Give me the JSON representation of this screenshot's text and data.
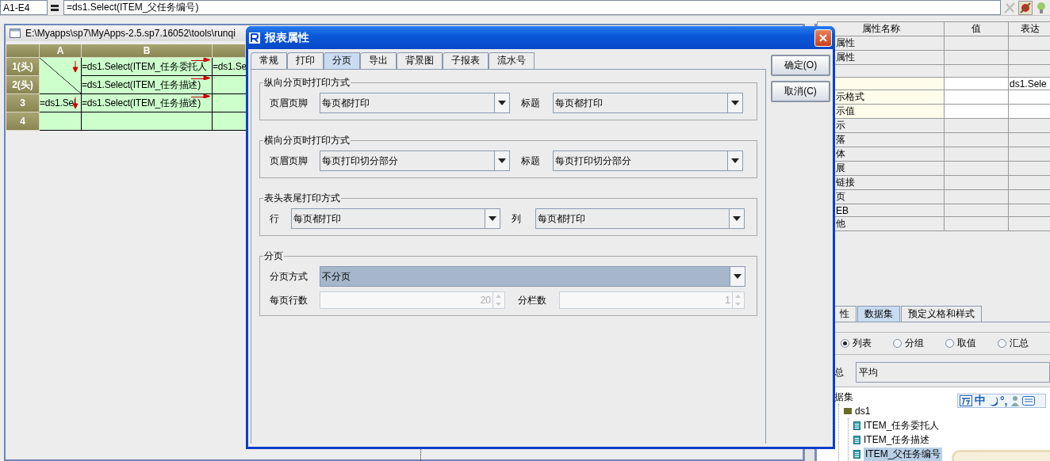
{
  "formula_bar": {
    "cell_ref": "A1-E4",
    "formula": "=ds1.Select(ITEM_父任务编号)"
  },
  "editor": {
    "title": "E:\\Myapps\\sp7\\MyApps-2.5.sp7.16052\\tools\\runqi",
    "columns": [
      "A",
      "B"
    ],
    "rows": [
      {
        "header": "1(头)",
        "cells": [
          {
            "kind": "diagonal",
            "down_arrow": true
          },
          {
            "kind": "text",
            "text": "=ds1.Select(ITEM_任务委托人",
            "right_arrow": true
          },
          {
            "kind": "text",
            "text": "=ds1.Se"
          }
        ]
      },
      {
        "header": "2(头)",
        "cells": [
          {
            "kind": "merged"
          },
          {
            "kind": "text",
            "text": "=ds1.Select(ITEM_任务描述)",
            "right_arrow": true
          },
          {
            "kind": "text"
          }
        ]
      },
      {
        "header": "3",
        "cells": [
          {
            "kind": "text",
            "text": "=ds1.Sel",
            "down_arrow": true
          },
          {
            "kind": "text",
            "text": "=ds1.Select(ITEM_任务描述)",
            "right_arrow": true
          },
          {
            "kind": "text"
          }
        ]
      },
      {
        "header": "4",
        "cells": [
          {
            "kind": "text"
          },
          {
            "kind": "text"
          },
          {
            "kind": "text"
          }
        ]
      }
    ]
  },
  "properties": {
    "columns": [
      "属性名称",
      "值",
      "表达"
    ],
    "rows": [
      {
        "name": "属性",
        "highlighted": false
      },
      {
        "name": "属性",
        "highlighted": false
      },
      {
        "highlighted": false
      },
      {
        "highlighted": true,
        "expression": "ds1.Sele"
      },
      {
        "name": "示格式",
        "highlighted": true
      },
      {
        "name": "示值",
        "highlighted": true
      },
      {
        "name": "示",
        "highlighted": false
      },
      {
        "name": "落",
        "highlighted": false
      },
      {
        "name": "体",
        "highlighted": false
      },
      {
        "name": "展",
        "highlighted": false
      },
      {
        "name": "链接",
        "highlighted": false
      },
      {
        "name": "页",
        "highlighted": false
      },
      {
        "name": "EB",
        "highlighted": false
      },
      {
        "name": "他",
        "highlighted": false
      }
    ]
  },
  "dataset_panel": {
    "tabs": [
      {
        "label": "性",
        "selected": false
      },
      {
        "label": "数据集",
        "selected": true
      },
      {
        "label": "预定义格和样式",
        "selected": false
      }
    ],
    "radios": [
      {
        "label": "列表",
        "selected": true
      },
      {
        "label": "分组",
        "selected": false
      },
      {
        "label": "取值",
        "selected": false
      },
      {
        "label": "汇总",
        "selected": false
      }
    ],
    "field_label": "总",
    "field_value": "平均",
    "tree": {
      "label": "据集",
      "children": [
        {
          "label": "ds1",
          "children": [
            {
              "label": "ITEM_任务委托人",
              "selected": false
            },
            {
              "label": "ITEM_任务描述",
              "selected": false
            },
            {
              "label": "ITEM_父任务编号",
              "selected": true
            }
          ]
        }
      ]
    },
    "ime": {
      "mode": "中",
      "punctuation": "°,"
    }
  },
  "dialog": {
    "title": "报表属性",
    "tabs": [
      {
        "label": "常规",
        "selected": false
      },
      {
        "label": "打印",
        "selected": false
      },
      {
        "label": "分页",
        "selected": true
      },
      {
        "label": "导出",
        "selected": false
      },
      {
        "label": "背景图",
        "selected": false
      },
      {
        "label": "子报表",
        "selected": false
      },
      {
        "label": "流水号",
        "selected": false
      }
    ],
    "groups": [
      {
        "title": "纵向分页时打印方式",
        "fields": [
          {
            "kind": "combo",
            "label": "页眉页脚",
            "value": "每页都打印",
            "focused": false
          },
          {
            "kind": "combo",
            "label": "标题",
            "value": "每页都打印",
            "focused": false
          }
        ]
      },
      {
        "title": "横向分页时打印方式",
        "fields": [
          {
            "kind": "combo",
            "label": "页眉页脚",
            "value": "每页打印切分部分",
            "focused": false
          },
          {
            "kind": "combo",
            "label": "标题",
            "value": "每页打印切分部分",
            "focused": false
          }
        ]
      },
      {
        "title": "表头表尾打印方式",
        "fields": [
          {
            "kind": "combo",
            "label": "行",
            "value": "每页都打印",
            "focused": false
          },
          {
            "kind": "combo",
            "label": "列",
            "value": "每页都打印",
            "focused": false
          }
        ]
      },
      {
        "title": "分页",
        "fields": [
          {
            "kind": "combo",
            "label": "分页方式",
            "value": "不分页",
            "focused": true
          },
          {
            "kind": "spinner",
            "label": "每页行数",
            "value": "20",
            "disabled": true
          },
          {
            "kind": "spinner",
            "label": "分栏数",
            "value": "1",
            "disabled": true
          }
        ]
      }
    ],
    "buttons": [
      {
        "label": "确定(O)"
      },
      {
        "label": "取消(C)"
      }
    ]
  }
}
